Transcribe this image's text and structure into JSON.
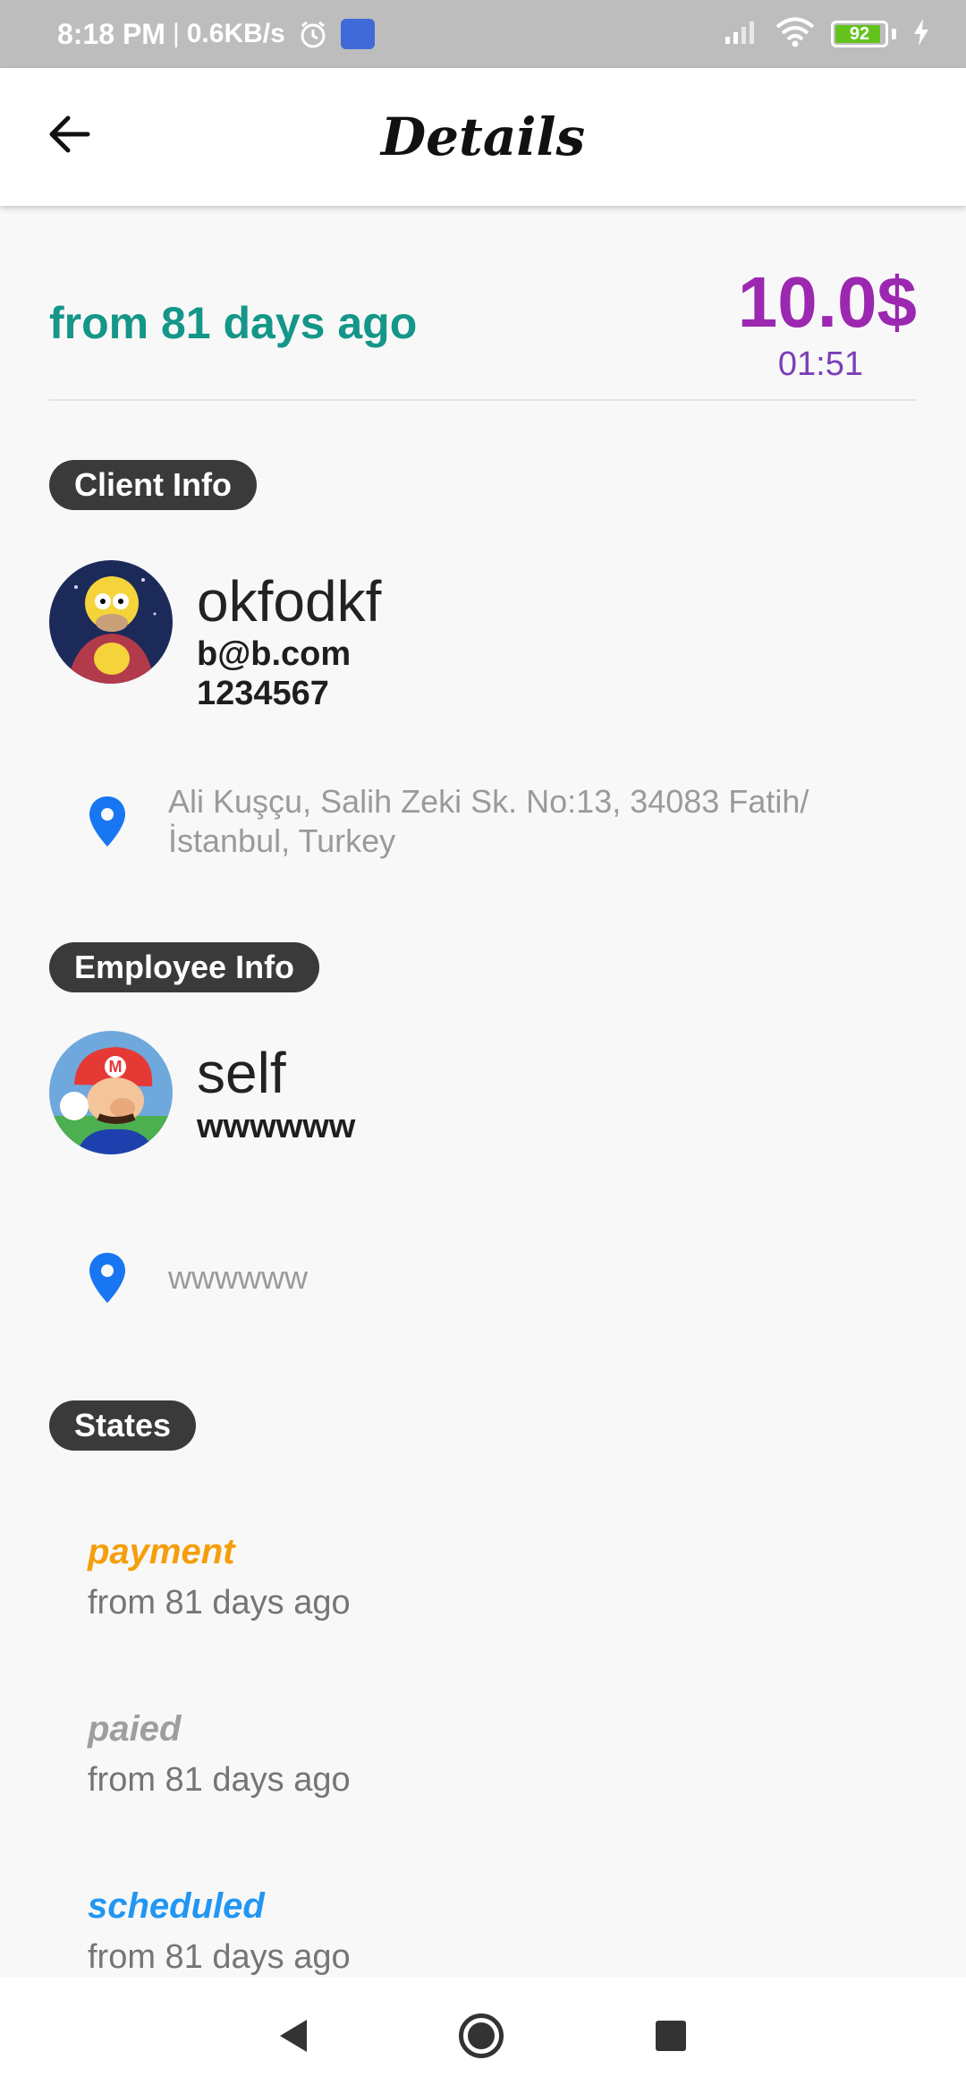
{
  "status_bar": {
    "time": "8:18 PM",
    "separator": "|",
    "speed": "0.6KB/s",
    "battery": "92",
    "icons": [
      "alarm-icon",
      "app-icon",
      "signal-icon",
      "wifi-icon",
      "battery-icon",
      "charging-icon"
    ]
  },
  "app_bar": {
    "title": "Details",
    "back_icon": "arrow-left-icon"
  },
  "summary": {
    "since": "from 81 days ago",
    "price": "10.0$",
    "time": "01:51",
    "colors": {
      "since": "#149688",
      "price": "#9c27b0",
      "time": "#7b3fb8"
    }
  },
  "client": {
    "section_label": "Client Info",
    "name": "okfodkf",
    "email": "b@b.com",
    "phone": "1234567",
    "address": "Ali Kuşçu, Salih Zeki Sk. No:13, 34083 Fatih/İstanbul, Turkey",
    "address_line1": "Ali Kuşçu, Salih Zeki Sk. No:13, 34083 Fatih/",
    "address_line2": "İstanbul, Turkey"
  },
  "employee": {
    "section_label": "Employee Info",
    "name": "self",
    "detail": "wwwwww",
    "address": "wwwwww"
  },
  "states": {
    "section_label": "States",
    "items": [
      {
        "title": "payment",
        "sub": "from 81 days ago",
        "color": "#f59e0b"
      },
      {
        "title": "paied",
        "sub": "from 81 days ago",
        "color": "#9e9e9e"
      },
      {
        "title": "scheduled",
        "sub": "from 81 days ago",
        "color": "#2196f3"
      }
    ]
  },
  "nav_bar": {
    "icons": [
      "nav-back-icon",
      "nav-home-icon",
      "nav-recents-icon"
    ]
  }
}
